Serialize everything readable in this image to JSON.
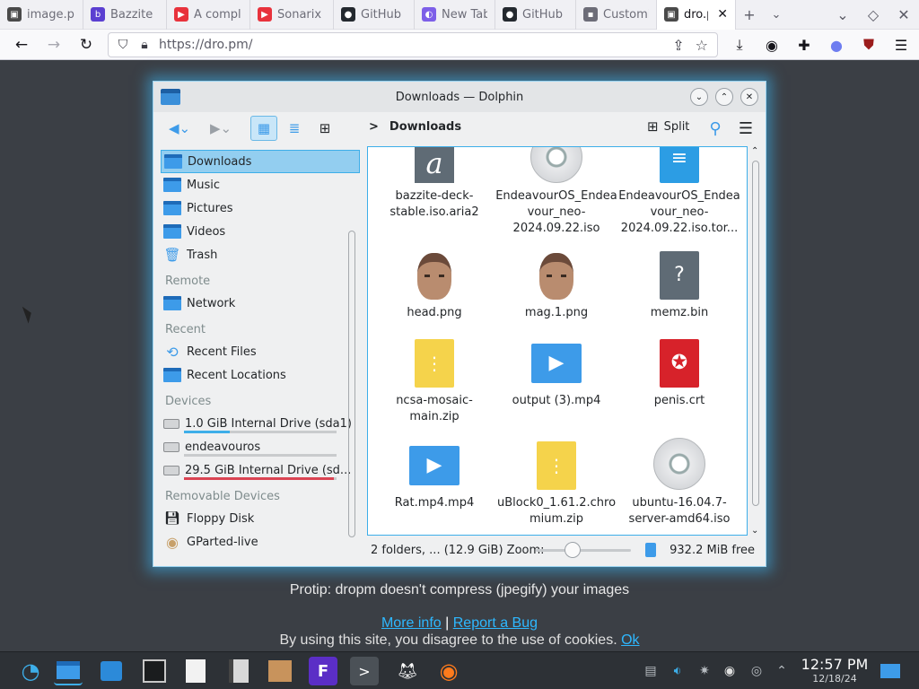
{
  "browser": {
    "tabs": [
      {
        "title": "image.p",
        "color": "#4a4a4a",
        "glyph": "▣"
      },
      {
        "title": "Bazzite",
        "color": "#5b3fd1",
        "glyph": "b"
      },
      {
        "title": "A compl",
        "color": "#e8323c",
        "glyph": "▶"
      },
      {
        "title": "Sonarix",
        "color": "#e8323c",
        "glyph": "▶"
      },
      {
        "title": "GitHub",
        "color": "#24292f",
        "glyph": "●"
      },
      {
        "title": "New Tab",
        "color": "#7d5fe8",
        "glyph": "◐"
      },
      {
        "title": "GitHub",
        "color": "#24292f",
        "glyph": "●"
      },
      {
        "title": "Customi",
        "color": "#6d6d78",
        "glyph": "▪"
      },
      {
        "title": "dro.pı",
        "color": "#4a4a4a",
        "glyph": "▣"
      }
    ],
    "new_tab_glyph": "+",
    "url": "https://dro.pm/"
  },
  "dolphin": {
    "title": "Downloads — Dolphin",
    "breadcrumb_sep": ">",
    "breadcrumb": "Downloads",
    "split_label": "Split",
    "sidebar": {
      "places": [
        {
          "label": "Downloads",
          "selected": true
        },
        {
          "label": "Music"
        },
        {
          "label": "Pictures"
        },
        {
          "label": "Videos"
        },
        {
          "label": "Trash"
        }
      ],
      "remote_header": "Remote",
      "remote": [
        {
          "label": "Network"
        }
      ],
      "recent_header": "Recent",
      "recent": [
        {
          "label": "Recent Files"
        },
        {
          "label": "Recent Locations"
        }
      ],
      "devices_header": "Devices",
      "devices": [
        {
          "label": "1.0 GiB Internal Drive (sda1)",
          "usage": 0.3,
          "bar_color": "#3daee9"
        },
        {
          "label": "endeavouros",
          "usage": 0.0,
          "bar_color": "#3daee9"
        },
        {
          "label": "29.5 GiB Internal Drive (sd...",
          "usage": 0.98,
          "bar_color": "#da4453"
        }
      ],
      "removable_header": "Removable Devices",
      "removable": [
        {
          "label": "Floppy Disk"
        },
        {
          "label": "GParted-live"
        }
      ]
    },
    "files": [
      {
        "name": "bazzite-deck-stable.iso.aria2",
        "icon": "aria2"
      },
      {
        "name": "EndeavourOS_Endeavour_neo-2024.09.22.iso",
        "icon": "disc"
      },
      {
        "name": "EndeavourOS_Endeavour_neo-2024.09.22.iso.tor...",
        "icon": "torrent"
      },
      {
        "name": "head.png",
        "icon": "image"
      },
      {
        "name": "mag.1.png",
        "icon": "image"
      },
      {
        "name": "memz.bin",
        "icon": "unknown"
      },
      {
        "name": "ncsa-mosaic-main.zip",
        "icon": "zip"
      },
      {
        "name": "output (3).mp4",
        "icon": "video"
      },
      {
        "name": "penis.crt",
        "icon": "cert"
      },
      {
        "name": "Rat.mp4.mp4",
        "icon": "video"
      },
      {
        "name": "uBlock0_1.61.2.chromium.zip",
        "icon": "zip"
      },
      {
        "name": "ubuntu-16.04.7-server-amd64.iso",
        "icon": "disc"
      }
    ],
    "status": {
      "summary": "2 folders, ... (12.9 GiB) Zoom:",
      "zoom_level": 0.25,
      "free": "932.2 MiB free"
    }
  },
  "page": {
    "protip": "Protip: dropm doesn't compress (jpegify) your images",
    "more_info": "More info",
    "separator": "|",
    "report_bug": "Report a Bug",
    "cookie_text": "By using this site, you disagree to the use of cookies.",
    "cookie_ok": "Ok"
  },
  "taskbar": {
    "time": "12:57 PM",
    "date": "12/18/24"
  },
  "colors": {
    "accent": "#3daee9",
    "page_bg": "#3b3f45",
    "link": "#2eb8ff"
  }
}
